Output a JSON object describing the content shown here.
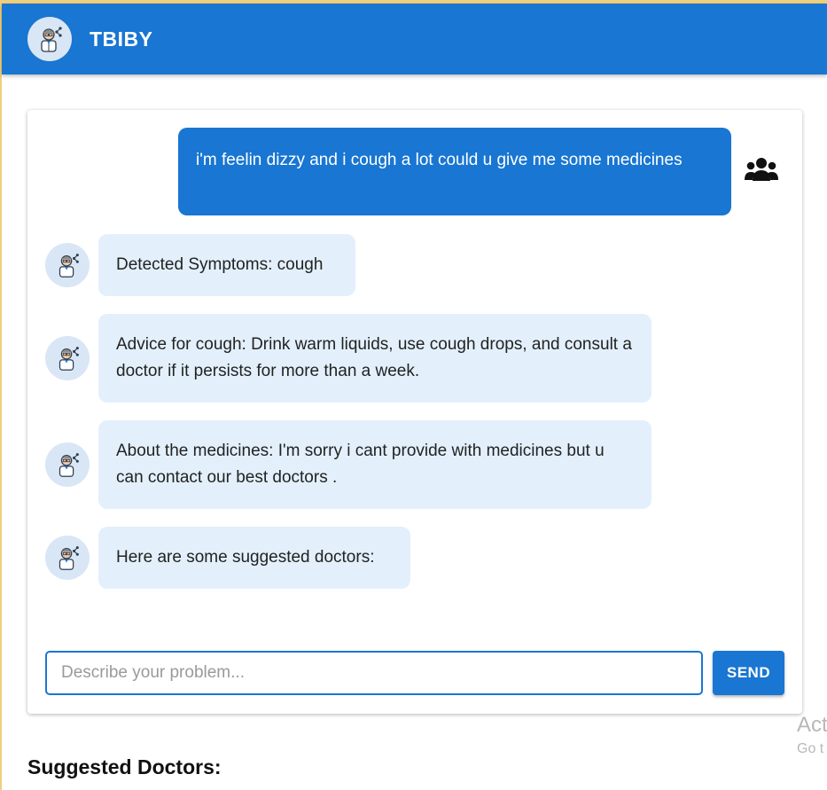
{
  "header": {
    "title": "TBIBY",
    "avatar_icon": "doctor-avatar-icon"
  },
  "chat": {
    "user_message": "i'm feelin dizzy and i cough a lot could u give me some medicines",
    "user_icon": "users-icon",
    "bot_messages": [
      "Detected Symptoms: cough",
      "Advice for cough: Drink warm liquids, use cough drops, and consult a doctor if it persists for more than a week.",
      "About the medicines: I'm sorry i cant provide with medicines but u can contact our best doctors .",
      "Here are some suggested doctors:"
    ]
  },
  "input": {
    "placeholder": "Describe your problem...",
    "value": "",
    "send_label": "SEND"
  },
  "suggested": {
    "heading": "Suggested Doctors:"
  },
  "watermark": {
    "line1": "Act",
    "line2": "Go t"
  },
  "colors": {
    "primary": "#1976d2",
    "bot_bubble": "#e3f0fc",
    "avatar_bg": "#d9e6f5",
    "outer_border": "#f0cf7a"
  }
}
